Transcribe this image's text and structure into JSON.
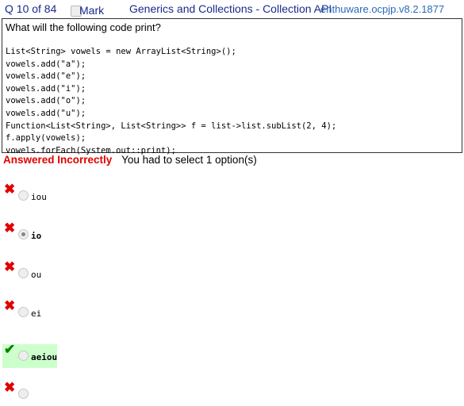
{
  "header": {
    "question_counter": "Q 10 of 84",
    "mark_label": "Mark",
    "topic": "Generics and Collections - Collection API",
    "question_id": "enthuware.ocpjp.v8.2.1877"
  },
  "question": {
    "prompt": "What will the following code print?",
    "code": "List<String> vowels = new ArrayList<String>();\nvowels.add(\"a\");\nvowels.add(\"e\");\nvowels.add(\"i\");\nvowels.add(\"o\");\nvowels.add(\"u\");\nFunction<List<String>, List<String>> f = list->list.subList(2, 4);\nf.apply(vowels);\nvowels.forEach(System.out::print);"
  },
  "status": {
    "result": "Answered Incorrectly",
    "hint": "You had to select 1 option(s)"
  },
  "options": [
    {
      "label": "iou",
      "correct": false,
      "selected": false
    },
    {
      "label": "io",
      "correct": false,
      "selected": true
    },
    {
      "label": "ou",
      "correct": false,
      "selected": false
    },
    {
      "label": "ei",
      "correct": false,
      "selected": false
    },
    {
      "label": "aeiou",
      "correct": true,
      "selected": false
    },
    {
      "label": "",
      "correct": false,
      "selected": false
    }
  ],
  "colors": {
    "incorrect": "#e00000",
    "correct": "#008000",
    "correct_bg": "#ccffcc",
    "header": "#1a2a8a",
    "link": "#2a6ab8"
  }
}
